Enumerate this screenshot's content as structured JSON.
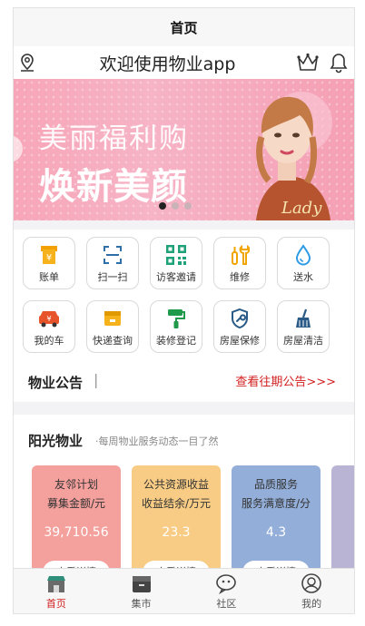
{
  "navbar": {
    "title": "首页"
  },
  "header": {
    "welcome": "欢迎使用物业app"
  },
  "banner": {
    "subtitle": "美丽福利购",
    "headline": "焕新美颜",
    "script_text": "Lady"
  },
  "services": [
    {
      "label": "账单",
      "icon": "bill-icon"
    },
    {
      "label": "扫一扫",
      "icon": "scan-icon"
    },
    {
      "label": "访客邀请",
      "icon": "qrcode-icon"
    },
    {
      "label": "维修",
      "icon": "repair-icon"
    },
    {
      "label": "送水",
      "icon": "water-drop-icon"
    },
    {
      "label": "我的车",
      "icon": "car-icon"
    },
    {
      "label": "快递查询",
      "icon": "package-icon"
    },
    {
      "label": "装修登记",
      "icon": "paint-roller-icon"
    },
    {
      "label": "房屋保修",
      "icon": "shield-wrench-icon"
    },
    {
      "label": "房屋清洁",
      "icon": "broom-icon"
    }
  ],
  "notice": {
    "title": "物业公告",
    "link": "查看往期公告>>>"
  },
  "section": {
    "title": "阳光物业",
    "subtitle": "·每周物业服务动态一目了然",
    "cards": [
      {
        "line1": "友邻计划",
        "line2": "募集金额/元",
        "value": "39,710.56",
        "button": "查看详情",
        "color": "#f4a09c"
      },
      {
        "line1": "公共资源收益",
        "line2": "收益结余/万元",
        "value": "23.3",
        "button": "查看详情",
        "color": "#f8cc84"
      },
      {
        "line1": "品质服务",
        "line2": "服务满意度/分",
        "value": "4.3",
        "button": "查看详情",
        "color": "#93aed8"
      }
    ]
  },
  "tabbar": [
    {
      "label": "首页",
      "icon": "home-store-icon",
      "active": true
    },
    {
      "label": "集市",
      "icon": "market-box-icon"
    },
    {
      "label": "社区",
      "icon": "chat-bubble-icon"
    },
    {
      "label": "我的",
      "icon": "profile-icon"
    }
  ],
  "colors": {
    "accent": "#d21f1f",
    "banner_pink": "#f6aec0"
  }
}
